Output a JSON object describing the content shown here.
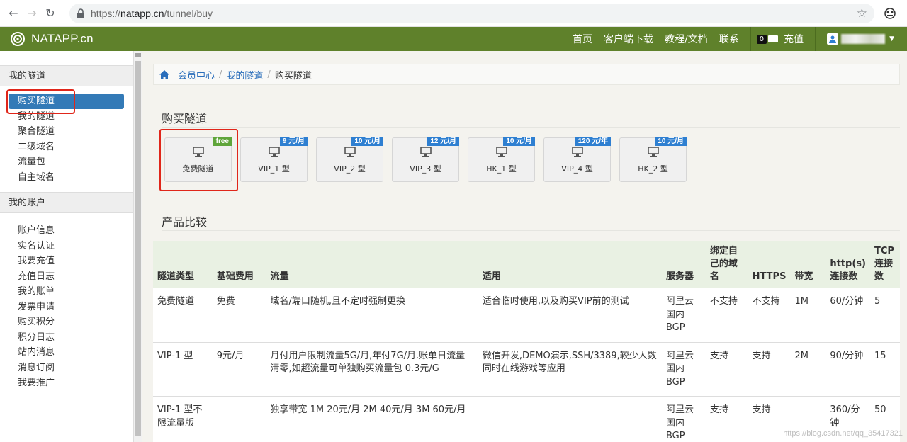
{
  "browser": {
    "url_host": "natapp.cn",
    "url_path": "/tunnel/buy",
    "url_prefix": "https://"
  },
  "navbar": {
    "brand": "NATAPP.cn",
    "links": [
      "首页",
      "客户端下载",
      "教程/文档",
      "联系"
    ],
    "balance": "0",
    "recharge": "充值"
  },
  "sidebar": {
    "sections": [
      {
        "title": "我的隧道",
        "items": [
          "购买隧道",
          "我的隧道",
          "聚合隧道",
          "二级域名",
          "流量包",
          "自主域名"
        ]
      },
      {
        "title": "我的账户",
        "items": [
          "账户信息",
          "实名认证",
          "我要充值",
          "充值日志",
          "我的账单",
          "发票申请",
          "购买积分",
          "积分日志",
          "站内消息",
          "消息订阅",
          "我要推广"
        ]
      }
    ],
    "active_item": "购买隧道"
  },
  "breadcrumb": [
    "会员中心",
    "我的隧道",
    "购买隧道"
  ],
  "buy_section": {
    "title": "购买隧道",
    "tiers": [
      {
        "label": "免费隧道",
        "price": "free"
      },
      {
        "label": "VIP_1 型",
        "price": "9 元/月"
      },
      {
        "label": "VIP_2 型",
        "price": "10 元/月"
      },
      {
        "label": "VIP_3 型",
        "price": "12 元/月"
      },
      {
        "label": "HK_1 型",
        "price": "10 元/月"
      },
      {
        "label": "VIP_4 型",
        "price": "120 元/年"
      },
      {
        "label": "HK_2 型",
        "price": "10 元/月"
      }
    ]
  },
  "compare_section": {
    "title": "产品比较",
    "headers": [
      "隧道类型",
      "基础费用",
      "流量",
      "适用",
      "服务器",
      "绑定自己的域名",
      "HTTPS",
      "带宽",
      "http(s)连接数",
      "TCP连接数"
    ],
    "rows": [
      [
        "免费隧道",
        "免费",
        "域名/端口随机,且不定时强制更换",
        "适合临时使用,以及购买VIP前的测试",
        "阿里云国内BGP",
        "不支持",
        "不支持",
        "1M",
        "60/分钟",
        "5"
      ],
      [
        "VIP-1 型",
        "9元/月",
        "月付用户限制流量5G/月,年付7G/月.账单日流量清零,如超流量可单独购买流量包 0.3元/G",
        "微信开发,DEMO演示,SSH/3389,较少人数同时在线游戏等应用",
        "阿里云国内BGP",
        "支持",
        "支持",
        "2M",
        "90/分钟",
        "15"
      ],
      [
        "VIP-1 型不限流量版",
        "",
        "独享带宽 1M 20元/月 2M 40元/月 3M 60元/月",
        "",
        "阿里云国内BGP",
        "支持",
        "支持",
        "",
        "360/分钟",
        "50"
      ]
    ]
  },
  "watermark": "https://blog.csdn.net/qq_35417321"
}
